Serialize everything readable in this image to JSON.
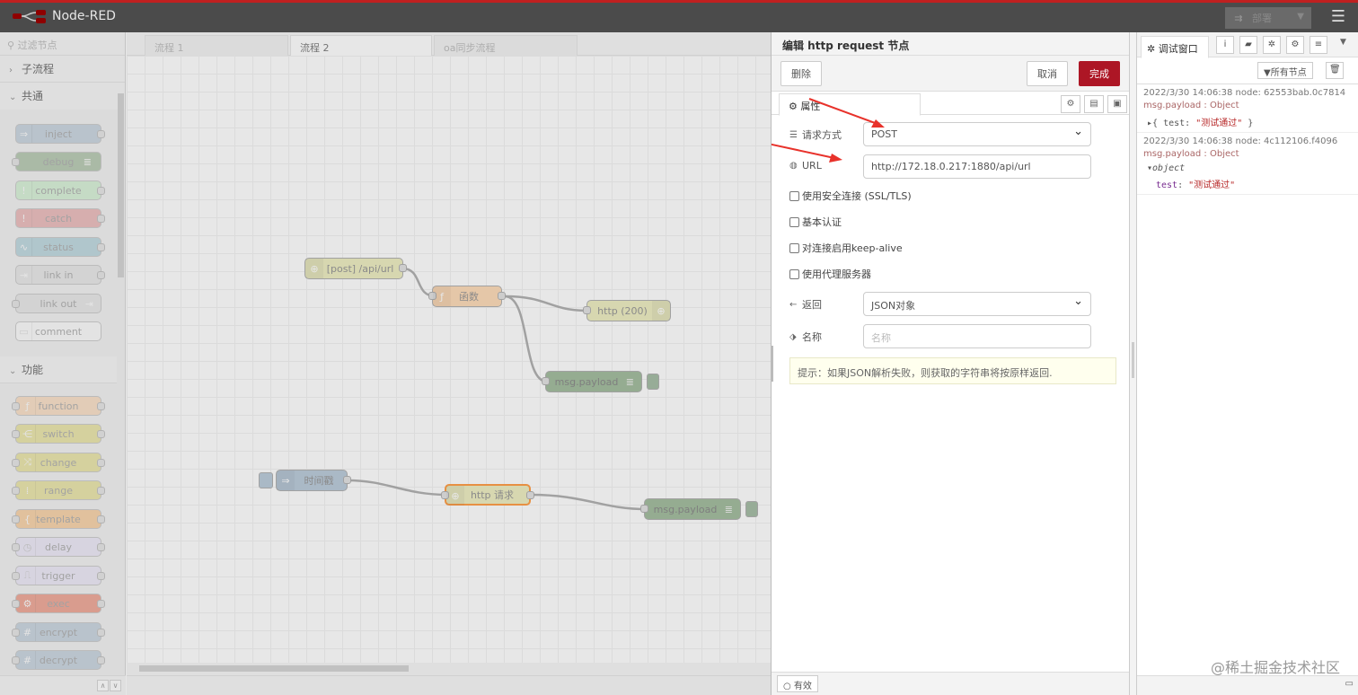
{
  "header": {
    "app_title": "Node-RED",
    "deploy_label": "部署",
    "logo_icon": "node-red-logo-icon",
    "menu_icon": "hamburger-menu-icon"
  },
  "palette": {
    "search_placeholder": "过滤节点",
    "categories": {
      "subflow": "子流程",
      "common": "共通",
      "function": "功能"
    },
    "common_nodes": [
      "inject",
      "debug",
      "complete",
      "catch",
      "status",
      "link in",
      "link out",
      "comment"
    ],
    "function_nodes": [
      "function",
      "switch",
      "change",
      "range",
      "template",
      "delay",
      "trigger",
      "exec",
      "encrypt",
      "decrypt"
    ]
  },
  "workspace": {
    "tabs": [
      "流程 1",
      "流程 2",
      "oa同步流程"
    ],
    "active_tab": "流程 2",
    "nodes": {
      "http_in": "[post] /api/url",
      "func": "函数",
      "http_resp": "http (200)",
      "debug1": "msg.payload",
      "inject": "时间戳",
      "http_req": "http 请求",
      "debug2": "msg.payload"
    }
  },
  "editor": {
    "title": "编辑 http request 节点",
    "delete_label": "删除",
    "cancel_label": "取消",
    "done_label": "完成",
    "tab_properties": "属性",
    "method_label": "请求方式",
    "method_value": "POST",
    "url_label": "URL",
    "url_value": "http://172.18.0.217:1880/api/url",
    "ssl_label": "使用安全连接 (SSL/TLS)",
    "basic_auth_label": "基本认证",
    "keepalive_label": "对连接启用keep-alive",
    "proxy_label": "使用代理服务器",
    "return_label": "返回",
    "return_value": "JSON对象",
    "name_label": "名称",
    "name_placeholder": "名称",
    "tip_text": "提示：如果JSON解析失败，则获取的字符串将按原样返回.",
    "status_label": "有效"
  },
  "sidebar": {
    "tab_debug": "调试窗口",
    "filter_label": "所有节点",
    "messages": [
      {
        "meta": "2022/3/30 14:06:38   node: 62553bab.0c7814",
        "topic": "msg.payload : Object",
        "key": "test",
        "value": "\"测试通过\""
      },
      {
        "meta": "2022/3/30 14:06:38   node: 4c112106.f4096",
        "topic": "msg.payload : Object",
        "object_label": "object",
        "key": "test",
        "value": "\"测试通过\""
      }
    ],
    "watermark": "@稀土掘金技术社区"
  },
  "colors": {
    "accent": "#ad1625",
    "header_bg": "#4b4b4b",
    "arrow": "#e8322b"
  }
}
